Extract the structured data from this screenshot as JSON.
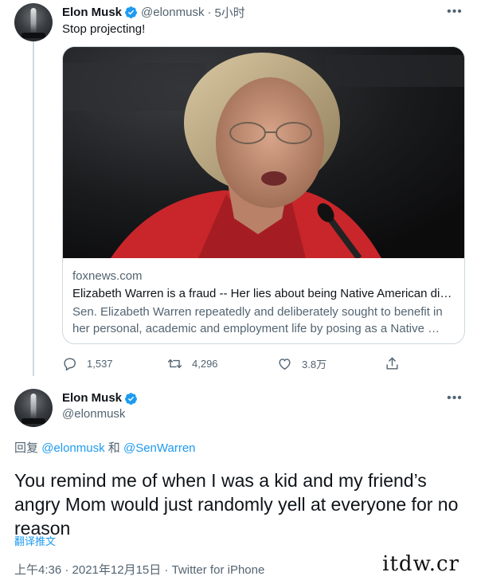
{
  "tweet1": {
    "author_name": "Elon Musk",
    "author_handle": "@elonmusk",
    "separator": "·",
    "time": "5小时",
    "text": "Stop projecting!",
    "card": {
      "domain": "foxnews.com",
      "title": "Elizabeth Warren is a fraud -- Her lies about being Native American dis…",
      "description": "Sen. Elizabeth Warren repeatedly and deliberately sought to benefit in her personal, academic and employment life by posing as a Native …"
    },
    "actions": {
      "replies": "1,537",
      "retweets": "4,296",
      "likes": "3.8万"
    }
  },
  "tweet2": {
    "author_name": "Elon Musk",
    "author_handle": "@elonmusk",
    "reply_prefix": "回复",
    "mention1": "@elonmusk",
    "reply_and": "和",
    "mention2": "@SenWarren",
    "text": "You remind me of when I was a kid and my friend’s angry Mom would just randomly yell at everyone for no reason",
    "translate_label": "翻译推文",
    "meta": "上午4:36 · 2021年12月15日 · Twitter for iPhone"
  },
  "watermark": "itdw.cr",
  "colors": {
    "accent": "#1d9bf0",
    "text_primary": "#0f1419",
    "text_secondary": "#536471",
    "border": "#cfd9de"
  },
  "icons": [
    "verified-badge-icon",
    "more-options-icon",
    "reply-icon",
    "retweet-icon",
    "like-icon",
    "share-icon",
    "avatar-rocket-image"
  ]
}
